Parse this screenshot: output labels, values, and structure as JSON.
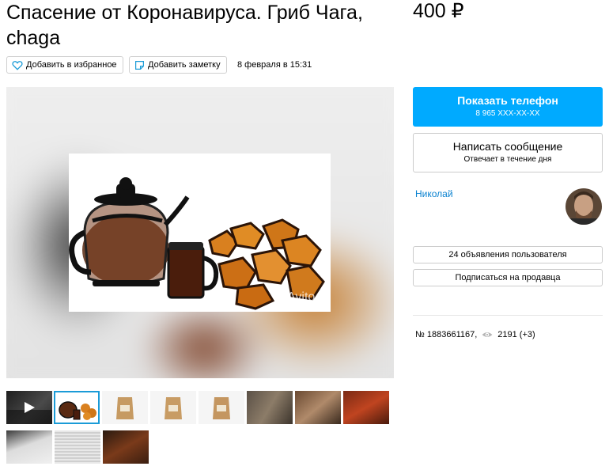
{
  "listing": {
    "title": "Спасение от Коронавируса. Гриб Чага, chaga",
    "price": "400 ₽",
    "favorite_label": "Добавить в избранное",
    "note_label": "Добавить заметку",
    "date": "8 февраля в 15:31",
    "watermark": "Avito"
  },
  "contact": {
    "phone_button_label": "Показать телефон",
    "phone_masked": "8 965 XXX-XX-XX",
    "message_button_label": "Написать сообщение",
    "message_hint": "Отвечает в течение дня"
  },
  "seller": {
    "name": "Николай",
    "listings_button_label": "24 объявления пользователя",
    "subscribe_button_label": "Подписаться на продавца"
  },
  "stats": {
    "ad_number": "№ 1883661167,",
    "views": "2191 (+3)"
  },
  "gallery": {
    "thumbnail_count": 11,
    "selected_index": 1
  },
  "colors": {
    "accent_blue": "#00aaff",
    "link_blue": "#0a82d0",
    "selected_border": "#1a9bd7"
  },
  "icons": {
    "favorite": "heart-outline-icon",
    "note": "note-icon",
    "views": "eye-icon",
    "play": "play-icon"
  }
}
